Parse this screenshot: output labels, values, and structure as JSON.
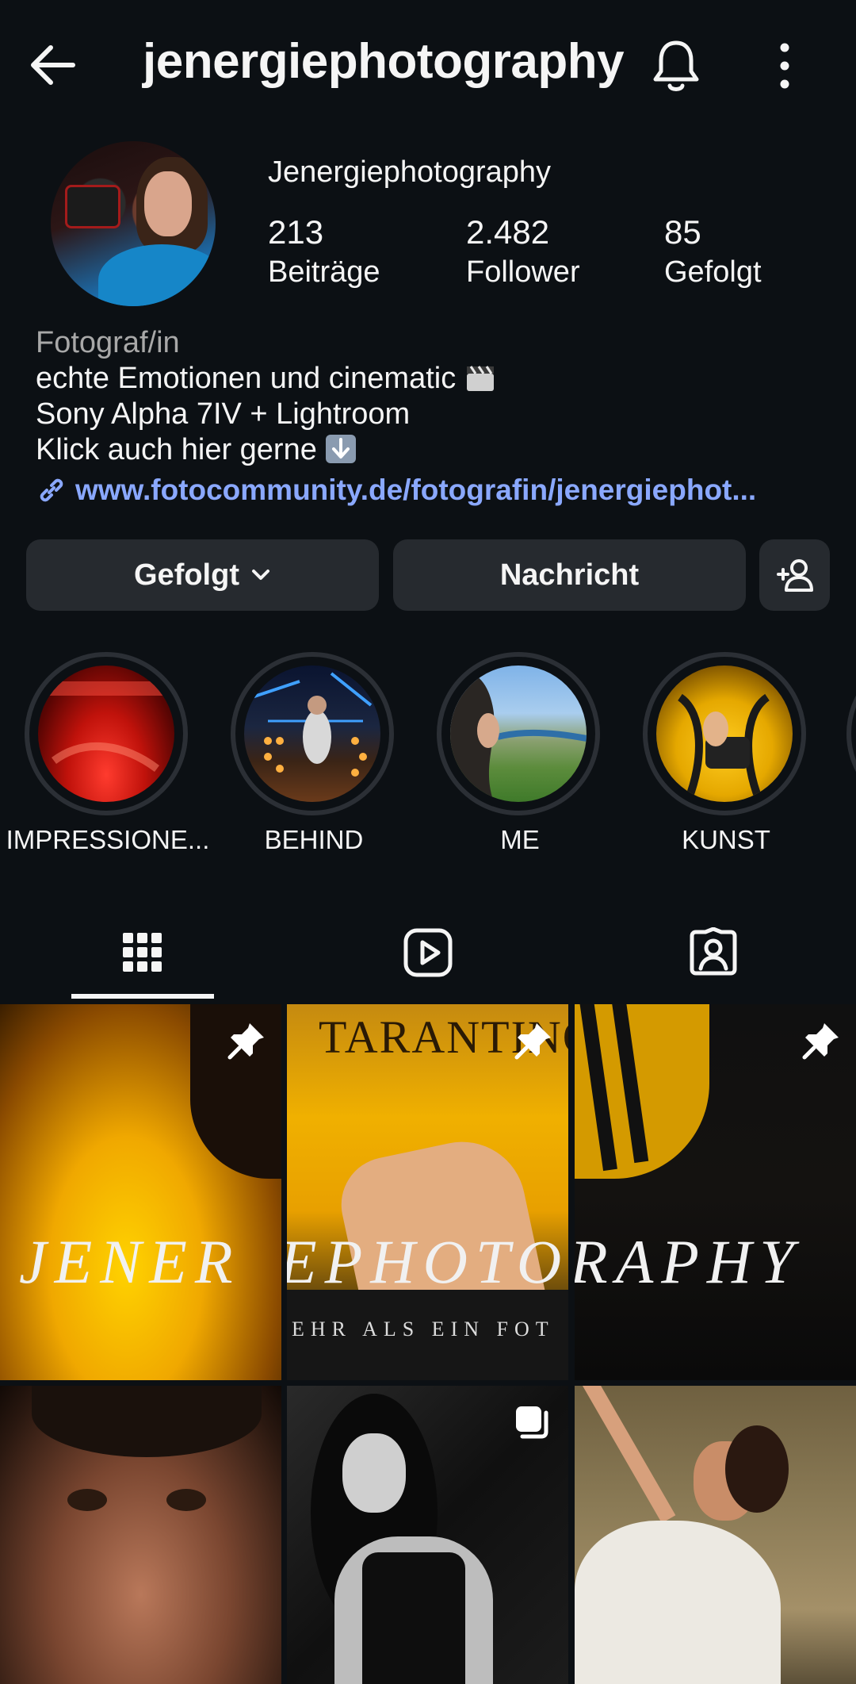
{
  "header": {
    "title": "jenergiephotography"
  },
  "profile": {
    "name": "Jenergiephotography",
    "stats": [
      {
        "value": "213",
        "label": "Beiträge"
      },
      {
        "value": "2.482",
        "label": "Follower"
      },
      {
        "value": "85",
        "label": "Gefolgt"
      }
    ],
    "bio": {
      "category": "Fotograf/in",
      "lines": [
        "echte Emotionen und cinematic",
        "Sony Alpha 7IV + Lightroom",
        "Klick auch hier gerne"
      ],
      "link": "www.fotocommunity.de/fotografin/jenergiephot..."
    }
  },
  "actions": {
    "follow_label": "Gefolgt",
    "message_label": "Nachricht"
  },
  "highlights": [
    {
      "label": "IMPRESSIONE..."
    },
    {
      "label": "BEHIND"
    },
    {
      "label": "ME"
    },
    {
      "label": "KUNST"
    }
  ],
  "tabs": [
    {
      "icon": "grid-icon",
      "active": true
    },
    {
      "icon": "reels-icon",
      "active": false
    },
    {
      "icon": "tagged-icon",
      "active": false
    }
  ],
  "grid": {
    "overlay_parts": [
      "JENER",
      "EPHOTO",
      "RAPHY"
    ],
    "tarantino_text": "TARANTINO",
    "subline": "EHR ALS EIN FOT"
  },
  "colors": {
    "background": "#0c1014",
    "button": "#262a2f",
    "link": "#8aa8ff",
    "secondary_text": "#a8a8a8"
  }
}
